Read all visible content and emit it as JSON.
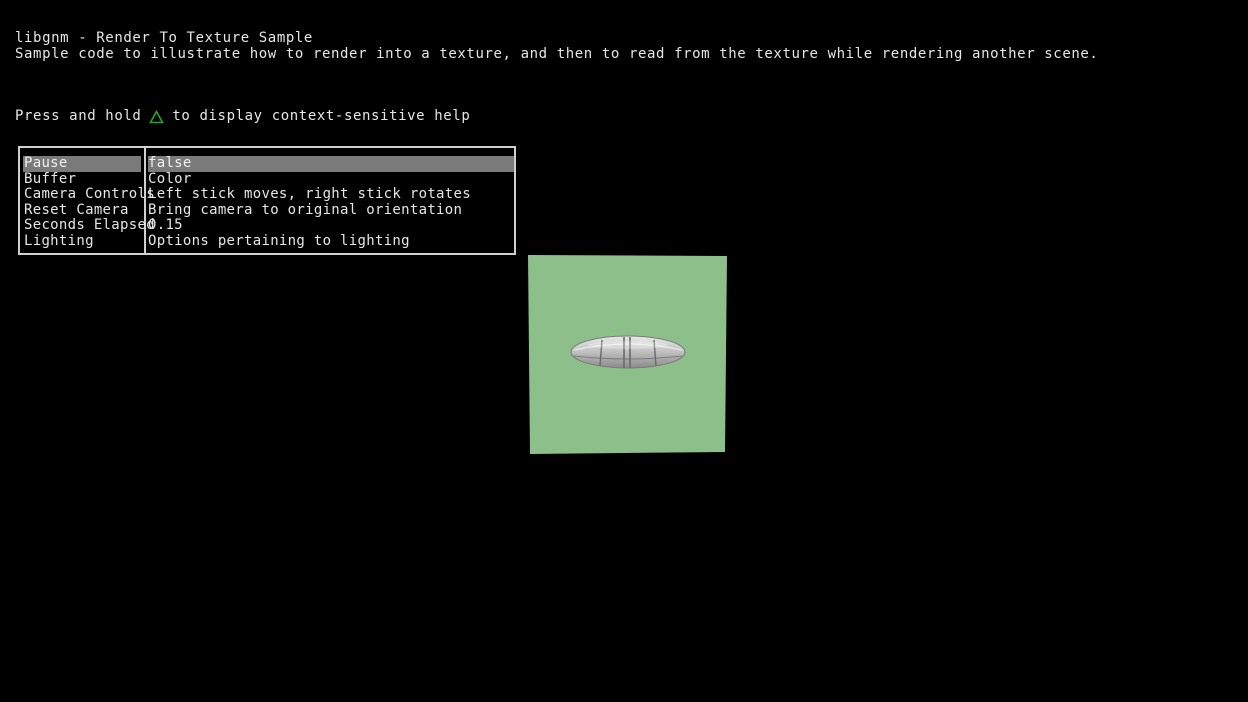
{
  "header": {
    "title": "libgnm - Render To Texture Sample",
    "subtitle": "Sample code to illustrate how to render into a texture, and then to read from the texture while rendering another scene."
  },
  "help": {
    "prefix": "Press and hold",
    "button_icon": "triangle-button-icon",
    "suffix": "to display context-sensitive help"
  },
  "menu": {
    "items": [
      {
        "key": "Pause",
        "value": "false"
      },
      {
        "key": "Buffer",
        "value": "Color"
      },
      {
        "key": "Camera Controls",
        "value": "Left stick moves, right stick rotates"
      },
      {
        "key": "Reset Camera",
        "value": "Bring camera to original orientation"
      },
      {
        "key": "Seconds Elapsed",
        "value": "0.15"
      },
      {
        "key": "Lighting",
        "value": "Options pertaining to lighting"
      }
    ],
    "selected_index": 0
  },
  "scene": {
    "quad_color": "#8dbf8b",
    "object_color": "#bdbdbd"
  },
  "colors": {
    "background": "#000000",
    "text": "#e6e6e6",
    "highlight": "#7a7a7a",
    "triangle": "#1fa82a"
  }
}
